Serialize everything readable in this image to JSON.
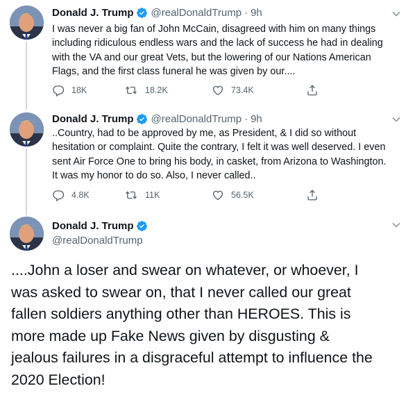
{
  "tweets": [
    {
      "name": "Donald J. Trump",
      "handle": "@realDonaldTrump",
      "separator": "·",
      "time": "9h",
      "text": "I was never a big fan of John McCain, disagreed with him on many things\nincluding ridiculous endless wars and the lack of success he had in dealing\nwith the VA and our great Vets, but the lowering of our Nations American\nFlags, and the first class funeral he was given by our....",
      "replies": "18K",
      "retweets": "18.2K",
      "likes": "73.4K"
    },
    {
      "name": "Donald J. Trump",
      "handle": "@realDonaldTrump",
      "separator": "·",
      "time": "9h",
      "text": "..Country, had to be approved by me, as President, & I did so without\nhesitation  or complaint. Quite the contrary, I felt it was well deserved. I even\nsent Air Force One to bring his body, in casket, from Arizona to Washington.\nIt was my honor to do so. Also, I never called..",
      "replies": "4.8K",
      "retweets": "11K",
      "likes": "56.5K"
    },
    {
      "name": "Donald J. Trump",
      "handle": "@realDonaldTrump",
      "text": "....John a loser and swear on whatever, or whoever, I\nwas asked to swear on, that I never called our great\nfallen soldiers anything other than HEROES. This is\nmore made up Fake News given by disgusting &\njealous failures in a disgraceful attempt to influence the\n2020 Election!"
    }
  ],
  "icons": {
    "verified": "verified-badge-icon",
    "chevron": "chevron-down-icon",
    "reply": "reply-icon",
    "retweet": "retweet-icon",
    "like": "heart-icon",
    "share": "share-icon"
  },
  "colors": {
    "verified": "#1d9bf0",
    "secondary_text": "#536471",
    "primary_text": "#0f1419",
    "thread_line": "#cfd9de"
  }
}
